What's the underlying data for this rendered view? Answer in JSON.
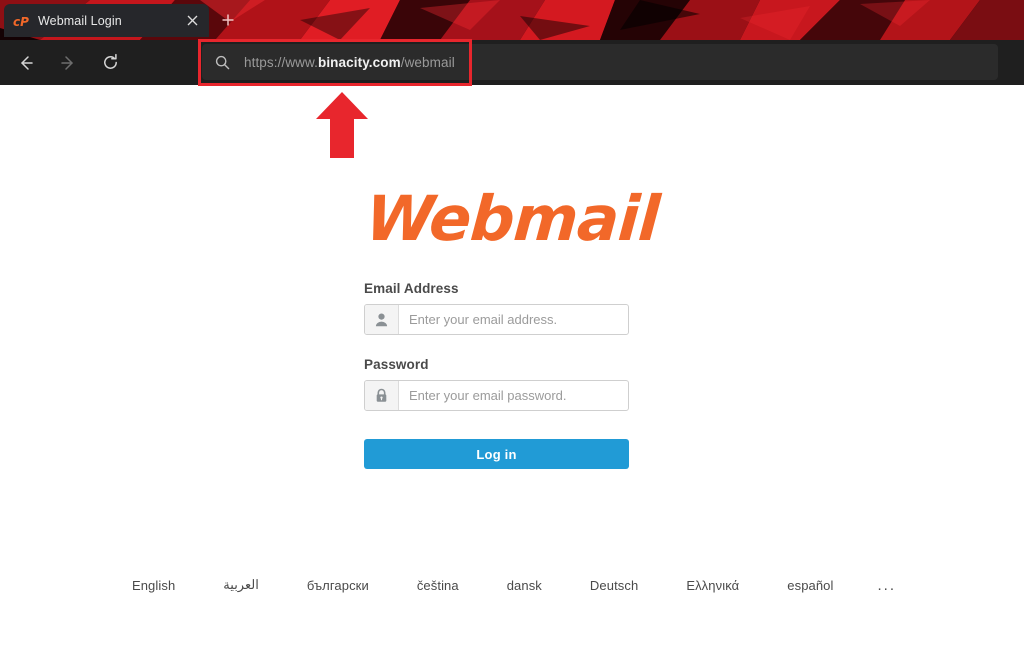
{
  "browser": {
    "tab": {
      "title": "Webmail Login",
      "favicon": "cpanel-cp-icon",
      "close_icon": "close-icon"
    },
    "new_tab_icon": "plus-icon",
    "nav": {
      "back_icon": "arrow-left-icon",
      "forward_icon": "arrow-right-icon",
      "reload_icon": "reload-icon"
    },
    "address_bar": {
      "search_icon": "search-icon",
      "url_scheme": "https://www.",
      "url_host": "binacity.com",
      "url_path": "/webmail",
      "full_url": "https://www.binacity.com/webmail"
    },
    "theme_accent": "#c4161c"
  },
  "annotations": {
    "highlight_rect": {
      "target": "address-bar",
      "color": "#e8262d"
    },
    "arrow": {
      "direction": "up",
      "color": "#e8262d",
      "points_to": "address-bar"
    }
  },
  "page": {
    "logo_text": "Webmail",
    "logo_color": "#f26829",
    "form": {
      "email": {
        "label": "Email Address",
        "placeholder": "Enter your email address.",
        "value": "",
        "icon": "user-icon"
      },
      "password": {
        "label": "Password",
        "placeholder": "Enter your email password.",
        "value": "",
        "icon": "lock-icon"
      },
      "submit_label": "Log in",
      "submit_color": "#219bd6"
    },
    "languages": [
      {
        "label": "English"
      },
      {
        "label": "العربية"
      },
      {
        "label": "български"
      },
      {
        "label": "čeština"
      },
      {
        "label": "dansk"
      },
      {
        "label": "Deutsch"
      },
      {
        "label": "Ελληνικά"
      },
      {
        "label": "español"
      }
    ],
    "languages_more": "..."
  }
}
